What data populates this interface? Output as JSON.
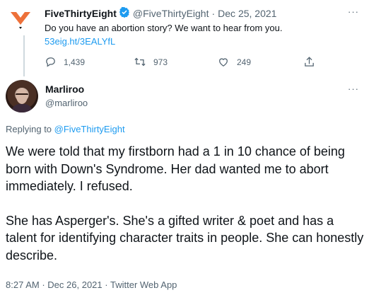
{
  "parent_tweet": {
    "author_name": "FiveThirtyEight",
    "handle": "@FiveThirtyEight",
    "separator": "·",
    "date": "Dec 25, 2021",
    "text": "Do you have an abortion story? We want to hear from you.",
    "link": "53eig.ht/3EALYfL",
    "more_label": "···",
    "stats": {
      "replies": "1,439",
      "retweets": "973",
      "likes": "249"
    }
  },
  "reply_tweet": {
    "author_name": "Marliroo",
    "handle": "@marliroo",
    "more_label": "···",
    "replying_prefix": "Replying to",
    "replying_to": "@FiveThirtyEight",
    "paragraphs": [
      "We were told that my firstborn had a 1 in 10 chance of being born with Down's Syndrome. Her dad wanted me to abort immediately. I refused.",
      "She has Asperger's. She's a gifted writer & poet and has a talent for identifying character traits in people. She can honestly describe."
    ],
    "time": "8:27 AM",
    "date": "Dec 26, 2021",
    "source": "Twitter Web App",
    "meta_separator": "·"
  },
  "colors": {
    "brand_orange": "#ED713A",
    "link_blue": "#1d9bf0",
    "muted": "#536471"
  }
}
